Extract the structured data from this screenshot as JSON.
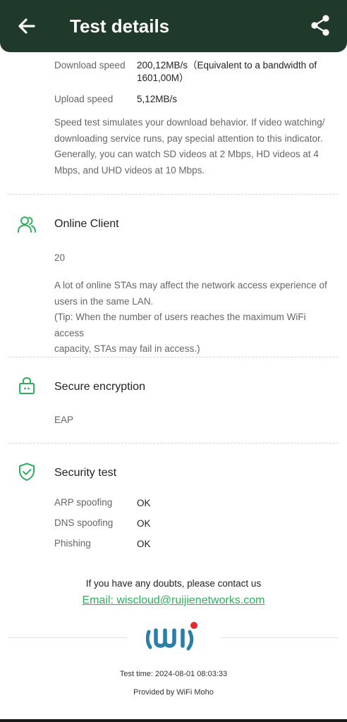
{
  "header": {
    "title": "Test details",
    "back_icon": "arrow-left-icon",
    "share_icon": "share-icon",
    "background": "#1f3a2b"
  },
  "speed": {
    "download_label": "Download speed",
    "download_value_line1": "200,12MB/s（Equivalent to a bandwidth of",
    "download_value_line2": "1601,00M）",
    "upload_label": "Upload speed",
    "upload_value": "5,12MB/s",
    "description": [
      "Speed test simulates your download behavior. If video watching/",
      "downloading service runs, pay special attention to this indicator.",
      "Generally, you can watch SD videos at 2 Mbps, HD videos at 4",
      "Mbps, and UHD videos at 10 Mbps."
    ]
  },
  "online_client": {
    "icon": "users-icon",
    "title": "Online Client",
    "value": "20",
    "description": [
      "A lot of online STAs may affect the network access experience of",
      "users in the same LAN.",
      "(Tip: When the number of users reaches the maximum WiFi access",
      "capacity, STAs may fail in access.)"
    ]
  },
  "secure_encryption": {
    "icon": "lock-icon",
    "title": "Secure encryption",
    "value": "EAP"
  },
  "security_test": {
    "icon": "shield-check-icon",
    "title": "Security test",
    "items": [
      {
        "label": "ARP spoofing",
        "value": "OK"
      },
      {
        "label": "DNS spoofing",
        "value": "OK"
      },
      {
        "label": "Phishing",
        "value": "OK"
      }
    ]
  },
  "contact": {
    "text": "If you have any doubts, please contact us",
    "email": "Email: wiscloud@ruijienetworks.com"
  },
  "footer": {
    "logo": "wifi-moho-logo",
    "test_time": "Test time: 2024-08-01 08:03:33",
    "provided_by": "Provided by WiFi Moho"
  },
  "colors": {
    "accent": "#2fae5d",
    "logo_blue": "#2a7fa8",
    "logo_red": "#e02b2b"
  }
}
